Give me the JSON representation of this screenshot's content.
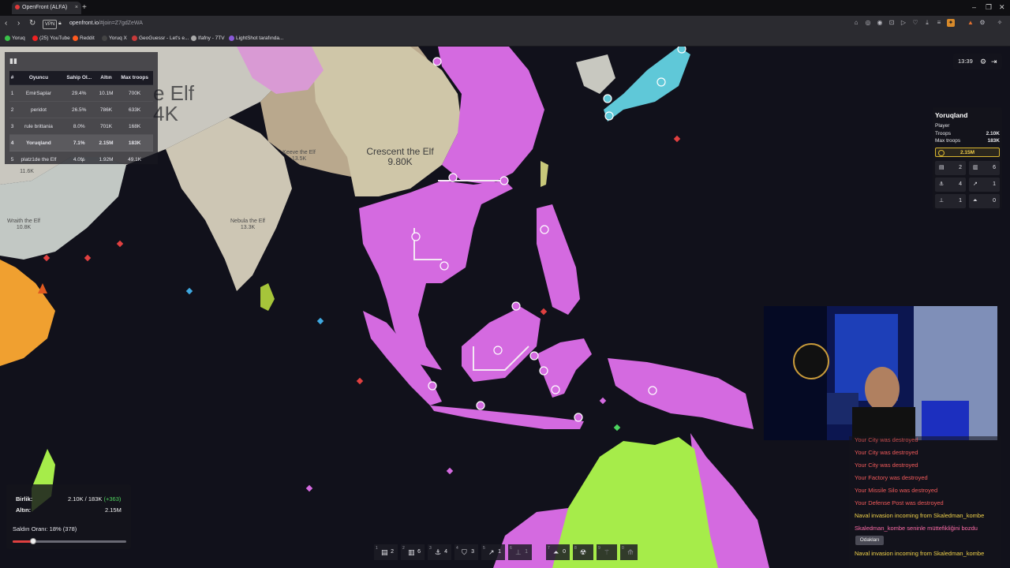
{
  "browser": {
    "tab_title": "OpenFront (ALFA)",
    "url_host": "openfront.io",
    "url_path": "/#join=Z7gdZeWA",
    "vpn_label": "VPN",
    "bookmarks": [
      "Yoruq",
      "(25) YouTube",
      "Reddit",
      "Yoruq X",
      "GeoGuessr - Let's e...",
      "Ifafny - 7TV",
      "LightShot tarafında..."
    ]
  },
  "map_labels": {
    "partial_title": "e Elf",
    "partial_count": "4K",
    "crescent_name": "Crescent the Elf",
    "crescent_count": "9.80K",
    "keeve_name": "Keeve the Elf",
    "keeve_count": "13.5K",
    "nebula_name": "Nebula the Elf",
    "nebula_count": "13.3K",
    "wraith_name": "Wraith the Elf",
    "wraith_count": "10.8K",
    "west_count": "11.6K"
  },
  "leaderboard": {
    "headers": [
      "#",
      "Oyuncu",
      "Sahip Ol...",
      "Altın",
      "Max troops"
    ],
    "rows": [
      {
        "rank": "1",
        "name": "EmirSaplar",
        "owned": "29.4%",
        "gold": "10.1M",
        "max": "700K"
      },
      {
        "rank": "2",
        "name": "peridot",
        "owned": "26.5%",
        "gold": "786K",
        "max": "633K"
      },
      {
        "rank": "3",
        "name": "rule brittania",
        "owned": "8.0%",
        "gold": "701K",
        "max": "168K"
      },
      {
        "rank": "4",
        "name": "Yoruqland",
        "owned": "7.1%",
        "gold": "2.15M",
        "max": "183K"
      },
      {
        "rank": "5",
        "name": "platz1de the Elf",
        "owned": "4.0%",
        "gold": "1.92M",
        "max": "49.1K"
      }
    ]
  },
  "timer": "13:39",
  "player_panel": {
    "name": "Yoruqland",
    "type": "Player",
    "troops_label": "Troops",
    "troops_value": "2.10K",
    "max_label": "Max troops",
    "max_value": "183K",
    "gold": "2.15M",
    "buildings": [
      "2",
      "6",
      "4",
      "1",
      "1",
      "0"
    ]
  },
  "log": {
    "messages": [
      {
        "text": "Your City was destroyed",
        "color": "red"
      },
      {
        "text": "Your City was destroyed",
        "color": "red"
      },
      {
        "text": "Your City was destroyed",
        "color": "red"
      },
      {
        "text": "Your Factory was destroyed",
        "color": "red"
      },
      {
        "text": "Your Missile Silo was destroyed",
        "color": "red"
      },
      {
        "text": "Your Defense Post was destroyed",
        "color": "red"
      },
      {
        "text": "Naval invasion incoming from Skaledman_kombe",
        "color": "yellow"
      },
      {
        "text": "Skaledman_kombe seninle müttefikliğini bozdu",
        "color": "pink"
      },
      {
        "text": "Naval invasion incoming from Skaledman_kombe",
        "color": "yellow"
      }
    ],
    "focus_button": "Odakları"
  },
  "stats": {
    "troops_label": "Birlik:",
    "troops_value": "2.10K / 183K",
    "troops_increase": "(+363)",
    "gold_label": "Altın:",
    "gold_value": "2.15M",
    "attack_ratio": "Saldırı Oranı: 18% (378)",
    "attack_ratio_level": 0.18
  },
  "build_bar": [
    {
      "key": "1",
      "icon": "city-icon",
      "count": "2"
    },
    {
      "key": "2",
      "icon": "factory-icon",
      "count": "6"
    },
    {
      "key": "3",
      "icon": "port-icon",
      "count": "4"
    },
    {
      "key": "4",
      "icon": "defense-post-icon",
      "count": "3"
    },
    {
      "key": "5",
      "icon": "missile-silo-icon",
      "count": "1"
    },
    {
      "key": "6",
      "icon": "sam-launcher-icon",
      "count": "1"
    },
    {
      "key": "7",
      "icon": "warship-icon",
      "count": "0"
    },
    {
      "key": "8",
      "icon": "atom-bomb-icon",
      "count": ""
    },
    {
      "key": "9",
      "icon": "hydrogen-bomb-icon",
      "count": ""
    },
    {
      "key": "0",
      "icon": "mirv-icon",
      "count": ""
    }
  ],
  "colors": {
    "player_territory": "#d46ae0",
    "ocean": "#11111b",
    "gold_accent": "#d8b530",
    "log_red": "#f05a5a",
    "log_yellow": "#f2d34a"
  }
}
